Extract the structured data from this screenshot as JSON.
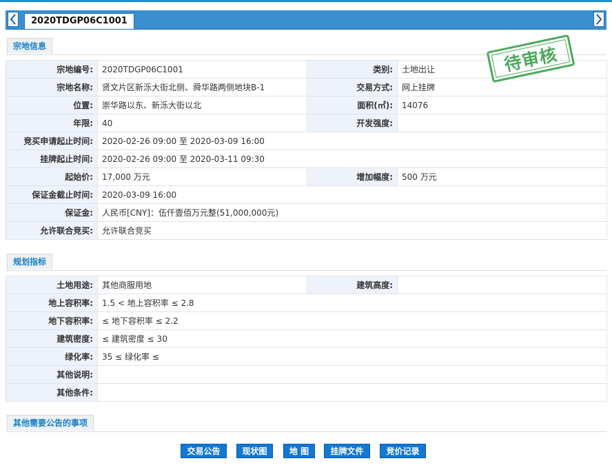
{
  "tab": {
    "label": "2020TDGP06C1001"
  },
  "stamp": {
    "text": "待审核"
  },
  "sections": {
    "land_info": "宗地信息",
    "planning": "规划指标",
    "other": "其他需要公告的事项"
  },
  "land_info": {
    "parcel_no_label": "宗地编号:",
    "parcel_no": "2020TDGP06C1001",
    "category_label": "类别:",
    "category": "土地出让",
    "parcel_name_label": "宗地名称:",
    "parcel_name": "贤文片区新泺大街北侧、舜华路两侧地块B-1",
    "trade_method_label": "交易方式:",
    "trade_method": "网上挂牌",
    "location_label": "位置:",
    "location": "崇华路以东、新泺大街以北",
    "area_label": "面积(㎡):",
    "area": "14076",
    "term_label": "年限:",
    "term": "40",
    "intensity_label": "开发强度:",
    "intensity": "",
    "bid_period_label": "竞买申请起止时间:",
    "bid_period": "2020-02-26 09:00 至 2020-03-09 16:00",
    "listing_period_label": "挂牌起止时间:",
    "listing_period": "2020-02-26 09:00 至 2020-03-11 09:30",
    "start_price_label": "起始价:",
    "start_price": "17,000 万元",
    "increment_label": "增加幅度:",
    "increment": "500 万元",
    "deposit_deadline_label": "保证金截止时间:",
    "deposit_deadline": "2020-03-09 16:00",
    "deposit_label": "保证金:",
    "deposit": "人民币[CNY]：伍仟壹佰万元整(51,000,000元)",
    "joint_bid_label": "允许联合竞买:",
    "joint_bid": "允许联合竞买"
  },
  "planning": {
    "land_use_label": "土地用途:",
    "land_use": "其他商服用地",
    "building_height_label": "建筑高度:",
    "building_height": "",
    "above_far_label": "地上容积率:",
    "above_far": "1.5 < 地上容积率 ≤ 2.8",
    "below_far_label": "地下容积率:",
    "below_far": "≤ 地下容积率 ≤ 2.2",
    "density_label": "建筑密度:",
    "density": "≤ 建筑密度 ≤ 30",
    "green_label": "绿化率:",
    "green": "35 ≤ 绿化率 ≤",
    "other_notes_label": "其他说明:",
    "other_notes": "",
    "other_conditions_label": "其他条件:",
    "other_conditions": ""
  },
  "buttons": {
    "announcement": "交易公告",
    "status_map": "现状图",
    "map": "地 图",
    "listing_docs": "挂牌文件",
    "bid_records": "竞价记录"
  },
  "colors": {
    "accent": "#1477d4",
    "tabbar": "#3b8fd0",
    "stamp": "#3aa14a",
    "label_bg": "#eef3fb"
  },
  "icons": {
    "prev": "chevron-left-icon",
    "next": "chevron-right-icon"
  }
}
